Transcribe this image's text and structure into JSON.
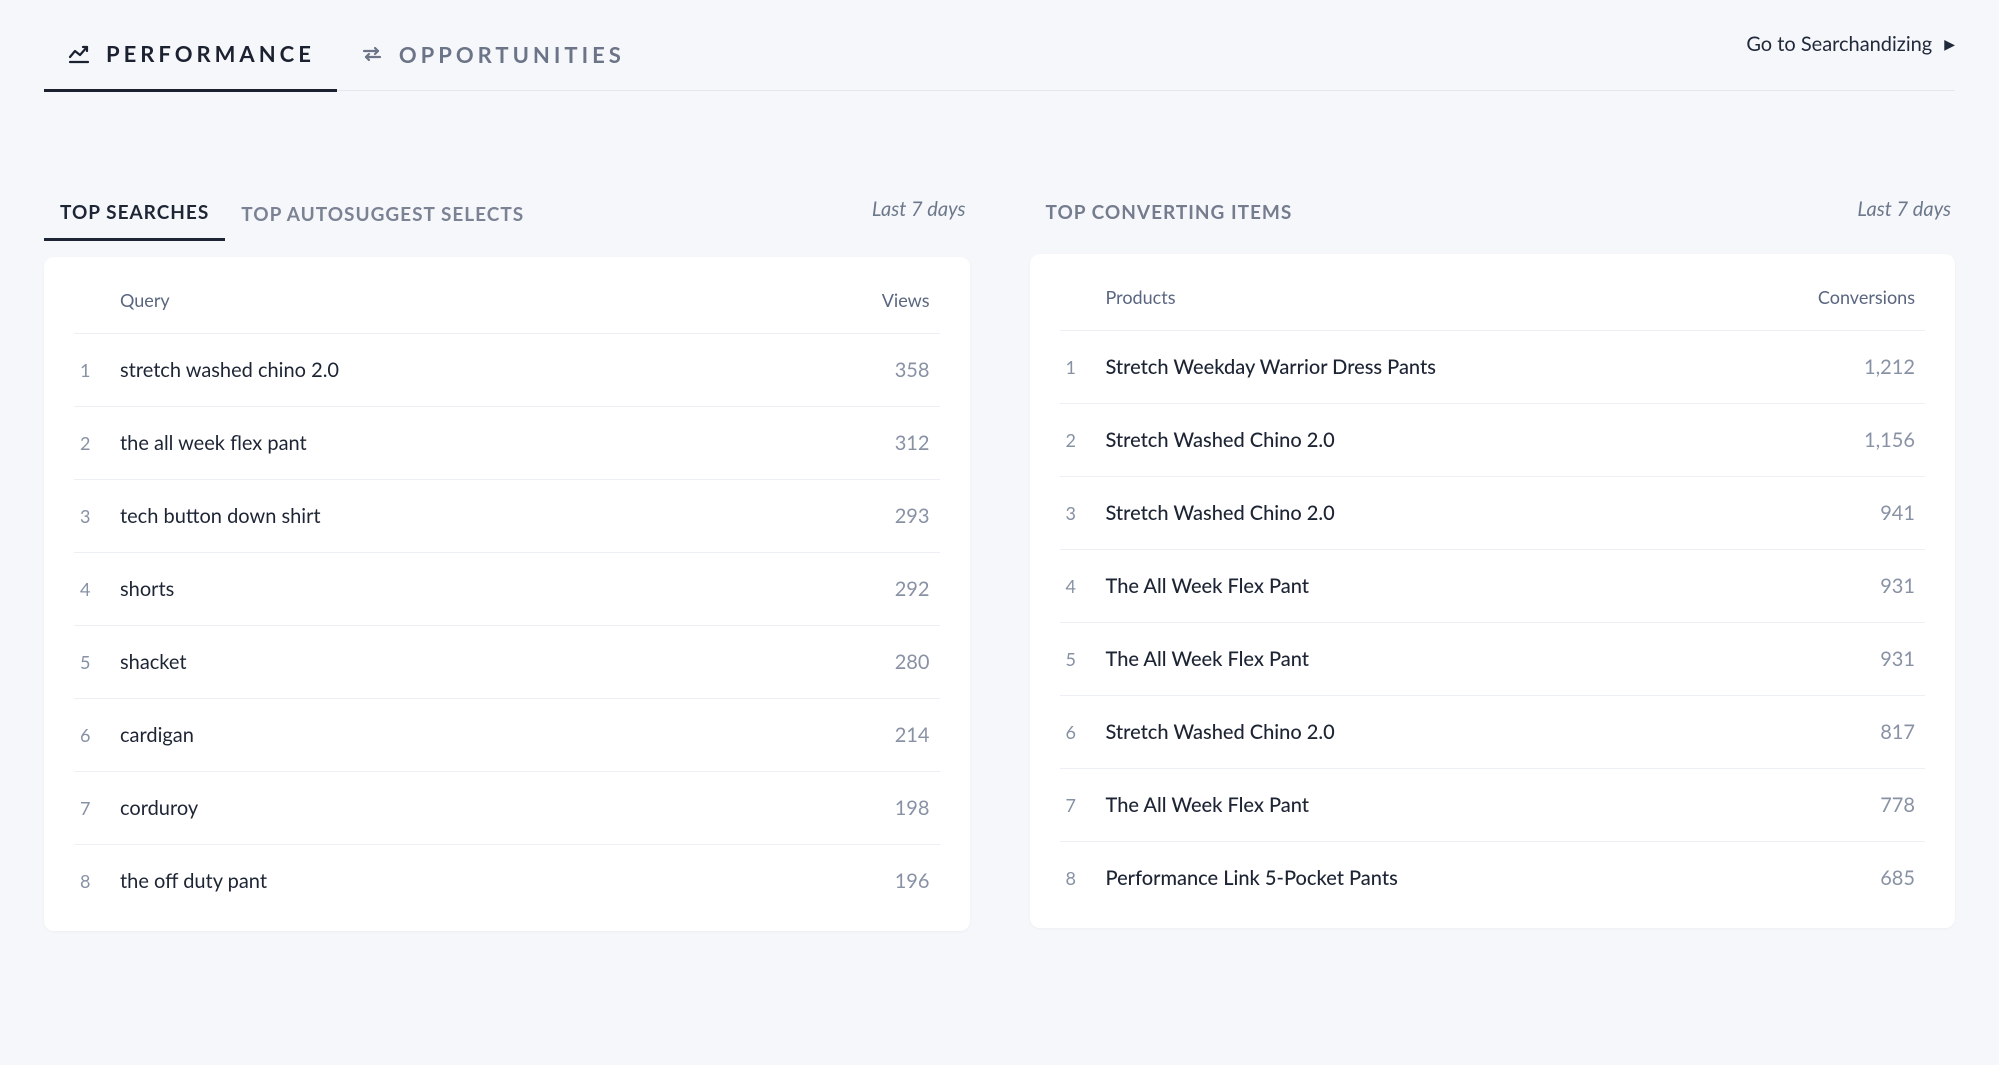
{
  "mainTabs": {
    "performance": "PERFORMANCE",
    "opportunities": "OPPORTUNITIES"
  },
  "headerLink": "Go to Searchandizing",
  "left": {
    "tabs": {
      "topSearches": "TOP SEARCHES",
      "topAutosuggest": "TOP AUTOSUGGEST SELECTS"
    },
    "timeRange": "Last 7 days",
    "columns": {
      "left": "Query",
      "right": "Views"
    },
    "rows": [
      {
        "idx": "1",
        "name": "stretch washed chino 2.0",
        "metric": "358"
      },
      {
        "idx": "2",
        "name": "the all week flex pant",
        "metric": "312"
      },
      {
        "idx": "3",
        "name": "tech button down shirt",
        "metric": "293"
      },
      {
        "idx": "4",
        "name": "shorts",
        "metric": "292"
      },
      {
        "idx": "5",
        "name": "shacket",
        "metric": "280"
      },
      {
        "idx": "6",
        "name": "cardigan",
        "metric": "214"
      },
      {
        "idx": "7",
        "name": "corduroy",
        "metric": "198"
      },
      {
        "idx": "8",
        "name": "the off duty pant",
        "metric": "196"
      }
    ]
  },
  "right": {
    "title": "TOP CONVERTING ITEMS",
    "timeRange": "Last 7 days",
    "columns": {
      "left": "Products",
      "right": "Conversions"
    },
    "rows": [
      {
        "idx": "1",
        "name": "Stretch Weekday Warrior Dress Pants",
        "metric": "1,212"
      },
      {
        "idx": "2",
        "name": "Stretch Washed Chino 2.0",
        "metric": "1,156"
      },
      {
        "idx": "3",
        "name": "Stretch Washed Chino 2.0",
        "metric": "941"
      },
      {
        "idx": "4",
        "name": "The All Week Flex Pant",
        "metric": "931"
      },
      {
        "idx": "5",
        "name": "The All Week Flex Pant",
        "metric": "931"
      },
      {
        "idx": "6",
        "name": "Stretch Washed Chino 2.0",
        "metric": "817"
      },
      {
        "idx": "7",
        "name": "The All Week Flex Pant",
        "metric": "778"
      },
      {
        "idx": "8",
        "name": "Performance Link 5-Pocket Pants",
        "metric": "685"
      }
    ]
  }
}
